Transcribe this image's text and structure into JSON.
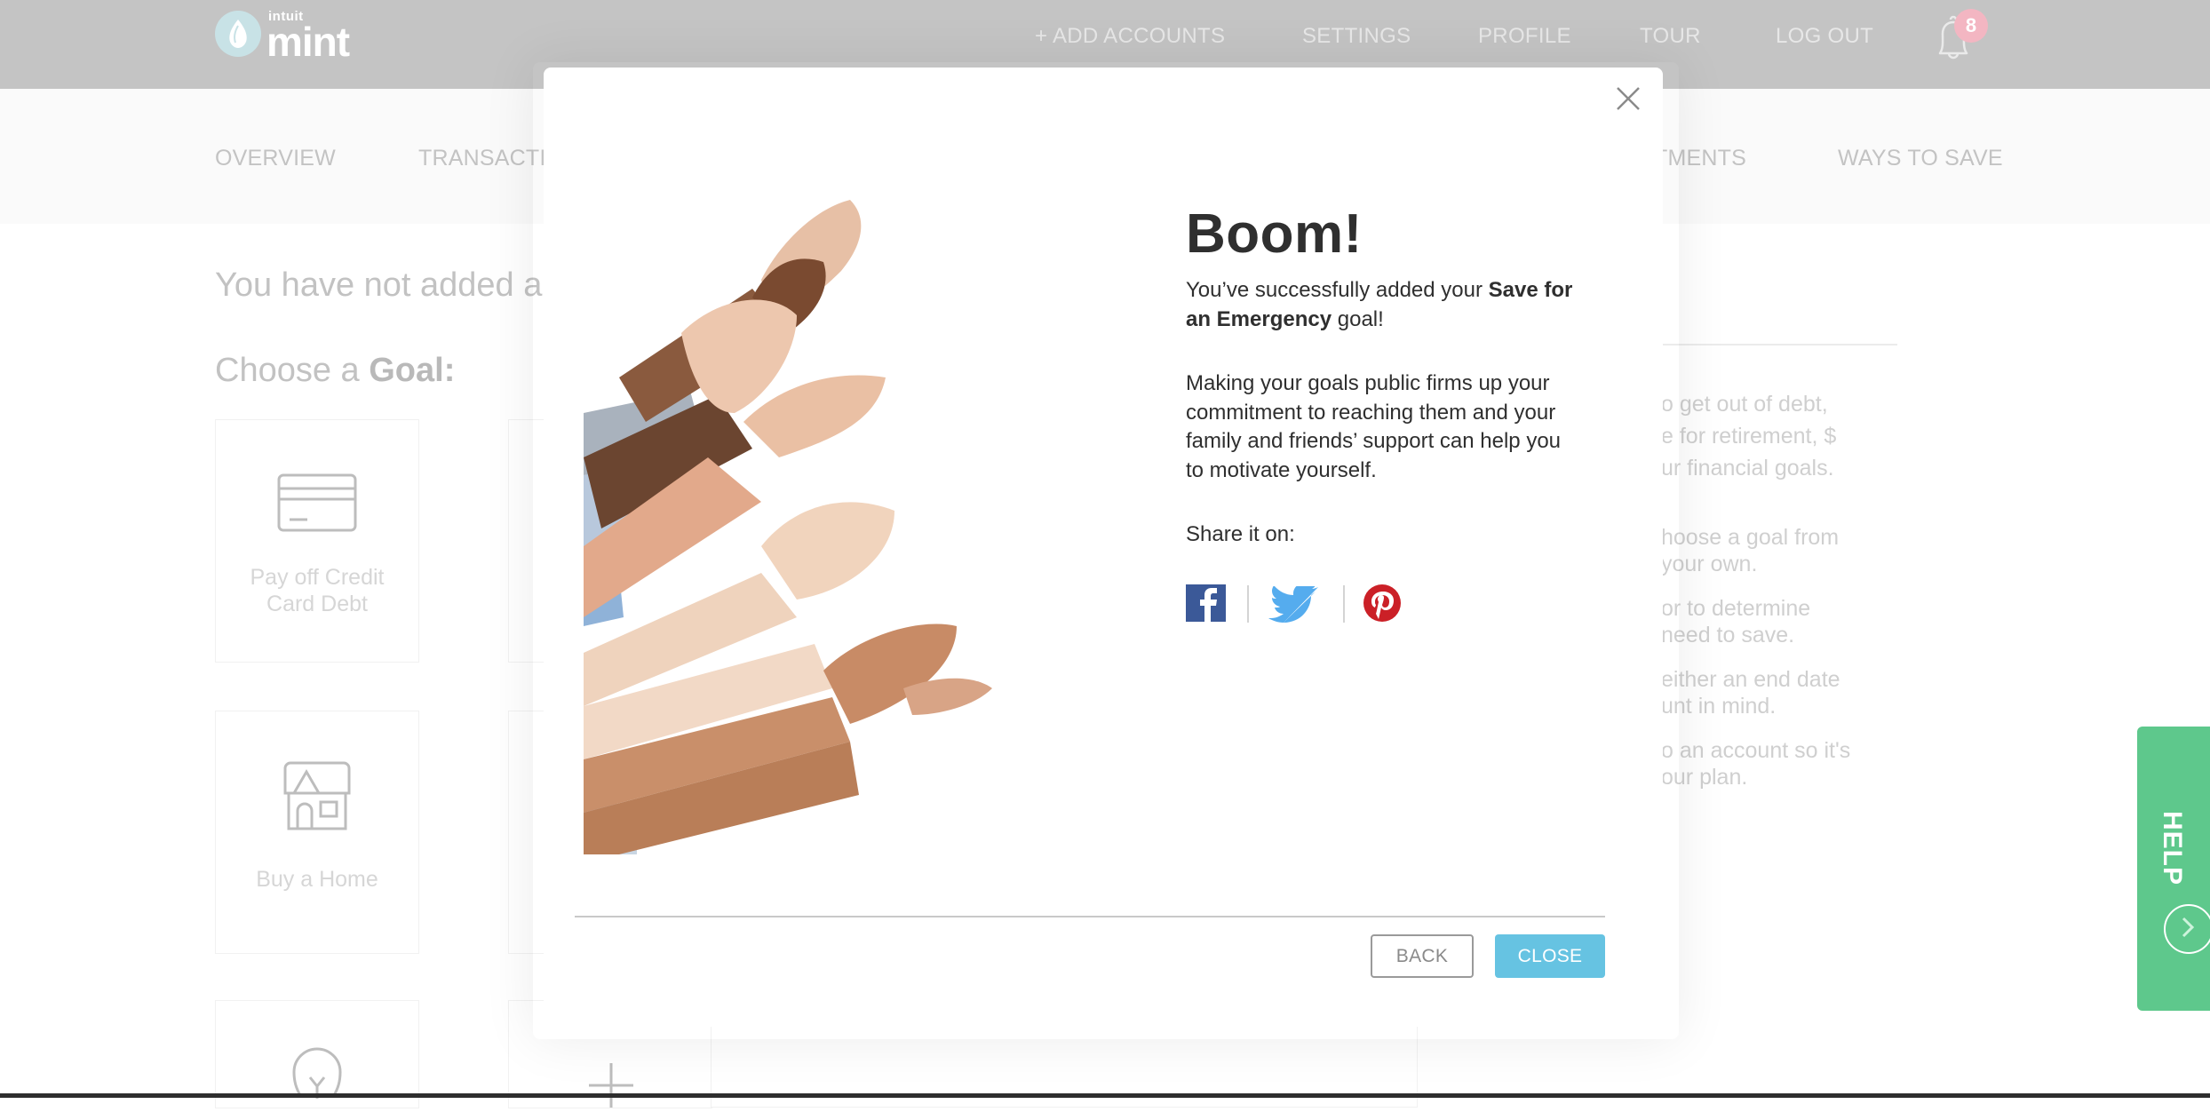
{
  "header": {
    "logo": {
      "brand_small": "intuit",
      "brand_large": "mint"
    },
    "nav": [
      {
        "label": "+ ADD ACCOUNTS"
      },
      {
        "label": "SETTINGS"
      },
      {
        "label": "PROFILE"
      },
      {
        "label": "TOUR"
      },
      {
        "label": "LOG OUT"
      }
    ],
    "notifications": {
      "icon": "bell-icon",
      "count": "8"
    }
  },
  "subnav": {
    "items": [
      {
        "label": "OVERVIEW"
      },
      {
        "label": "TRANSACTIO"
      },
      {
        "label": "TMENTS"
      },
      {
        "label": "WAYS TO SAVE"
      }
    ]
  },
  "page": {
    "heading": "You have not added an",
    "choose_prefix": "Choose a ",
    "choose_bold": "Goal:",
    "goal_cards": [
      {
        "label_line1": "Pay off Credit",
        "label_line2": "Card Debt",
        "icon": "credit-card-icon"
      },
      {
        "label_line1": "Buy a Home",
        "label_line2": "",
        "icon": "house-icon"
      },
      {
        "label_line1": "",
        "label_line2": "",
        "icon": "lightbulb-icon"
      },
      {
        "label_line1": "",
        "label_line2": "",
        "icon": "plus-icon"
      }
    ],
    "help_text": [
      "o get out of debt,",
      "e for retirement, $",
      "ur financial goals.",
      "hoose a goal from",
      " your own.",
      "or to determine",
      "need to save.",
      "either an end date",
      "unt in mind.",
      "o an account so it's",
      "our plan."
    ]
  },
  "help_tab": {
    "label": "HELP",
    "icon": "chevron-right-icon",
    "color": "#5ec88c"
  },
  "modal": {
    "title": "Boom!",
    "success_prefix": "You’ve successfully added your ",
    "success_goal": "Save for an Emergency",
    "success_suffix": " goal!",
    "body": "Making your goals public firms up your commitment to reaching them and your family and friends’ support can help you to motivate yourself.",
    "share_label": "Share it on:",
    "share": [
      {
        "network": "Facebook",
        "icon": "facebook-icon",
        "color": "#3b5998"
      },
      {
        "network": "Twitter",
        "icon": "twitter-icon",
        "color": "#55acee"
      },
      {
        "network": "Pinterest",
        "icon": "pinterest-icon",
        "color": "#cb2027"
      }
    ],
    "back_label": "BACK",
    "close_label": "CLOSE",
    "close_button_color": "#66c3e2"
  }
}
